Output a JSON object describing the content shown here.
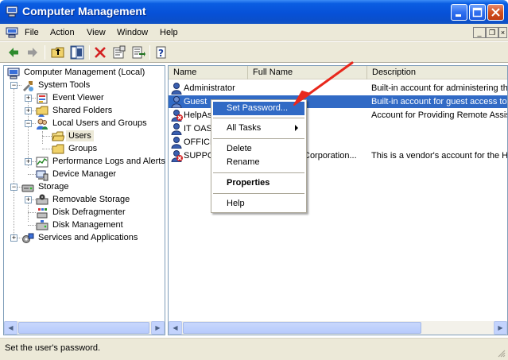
{
  "window": {
    "title": "Computer Management",
    "app_icon": "computer-management-icon"
  },
  "menu": [
    "File",
    "Action",
    "View",
    "Window",
    "Help"
  ],
  "toolbar": [
    "back-icon",
    "forward-icon",
    "up-folder-icon",
    "show-hide-tree-icon",
    "delete-icon",
    "properties-icon",
    "export-list-icon",
    "help-icon"
  ],
  "tree": {
    "root": "Computer Management (Local)",
    "system_tools": "System Tools",
    "event_viewer": "Event Viewer",
    "shared_folders": "Shared Folders",
    "local_users_groups": "Local Users and Groups",
    "users": "Users",
    "groups": "Groups",
    "perf_logs": "Performance Logs and Alerts",
    "device_manager": "Device Manager",
    "storage": "Storage",
    "removable_storage": "Removable Storage",
    "disk_defrag": "Disk Defragmenter",
    "disk_mgmt": "Disk Management",
    "services_apps": "Services and Applications"
  },
  "list": {
    "columns": [
      "Name",
      "Full Name",
      "Description"
    ],
    "rows": [
      {
        "name": "Administrator",
        "full_name": "",
        "description": "Built-in account for administering th",
        "disabled": false
      },
      {
        "name": "Guest",
        "full_name": "",
        "description": "Built-in account for guest access to",
        "disabled": false
      },
      {
        "name": "HelpAss",
        "full_name": "p Help Assi...",
        "description": "Account for Providing Remote Assis",
        "disabled": true
      },
      {
        "name": "IT OAS",
        "full_name": "",
        "description": "",
        "disabled": false
      },
      {
        "name": "OFFICE",
        "full_name": "",
        "description": "",
        "disabled": false
      },
      {
        "name": "SUPPO",
        "full_name": "Corporation...",
        "description": "This is a vendor's account for the H",
        "disabled": true
      }
    ]
  },
  "context_menu": {
    "set_password": "Set Password...",
    "all_tasks": "All Tasks",
    "delete": "Delete",
    "rename": "Rename",
    "properties": "Properties",
    "help": "Help"
  },
  "status": "Set the user's password.",
  "colors": {
    "selection": "#316ac5",
    "annotation_arrow": "#e8281c",
    "title_bar": "#0751d8"
  }
}
